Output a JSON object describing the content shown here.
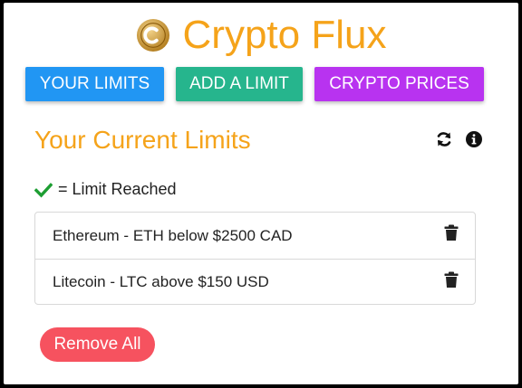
{
  "app": {
    "title": "Crypto Flux",
    "logo_icon": "bitcoin-coin-icon",
    "accent_color": "#f5a31a"
  },
  "nav": {
    "your_limits": "YOUR LIMITS",
    "add_limit": "ADD A LIMIT",
    "crypto_prices": "CRYPTO PRICES"
  },
  "section": {
    "title": "Your Current Limits",
    "refresh_icon": "refresh-icon",
    "info_icon": "info-icon"
  },
  "legend": {
    "icon": "checkmark-icon",
    "text": "= Limit Reached"
  },
  "limits": [
    {
      "coin": "Ethereum",
      "separator": " - ",
      "detail": "ETH below $2500 CAD",
      "delete_icon": "trash-icon"
    },
    {
      "coin": "Litecoin",
      "separator": " - ",
      "detail": "LTC above $150 USD",
      "delete_icon": "trash-icon"
    }
  ],
  "actions": {
    "remove_all": "Remove All"
  }
}
